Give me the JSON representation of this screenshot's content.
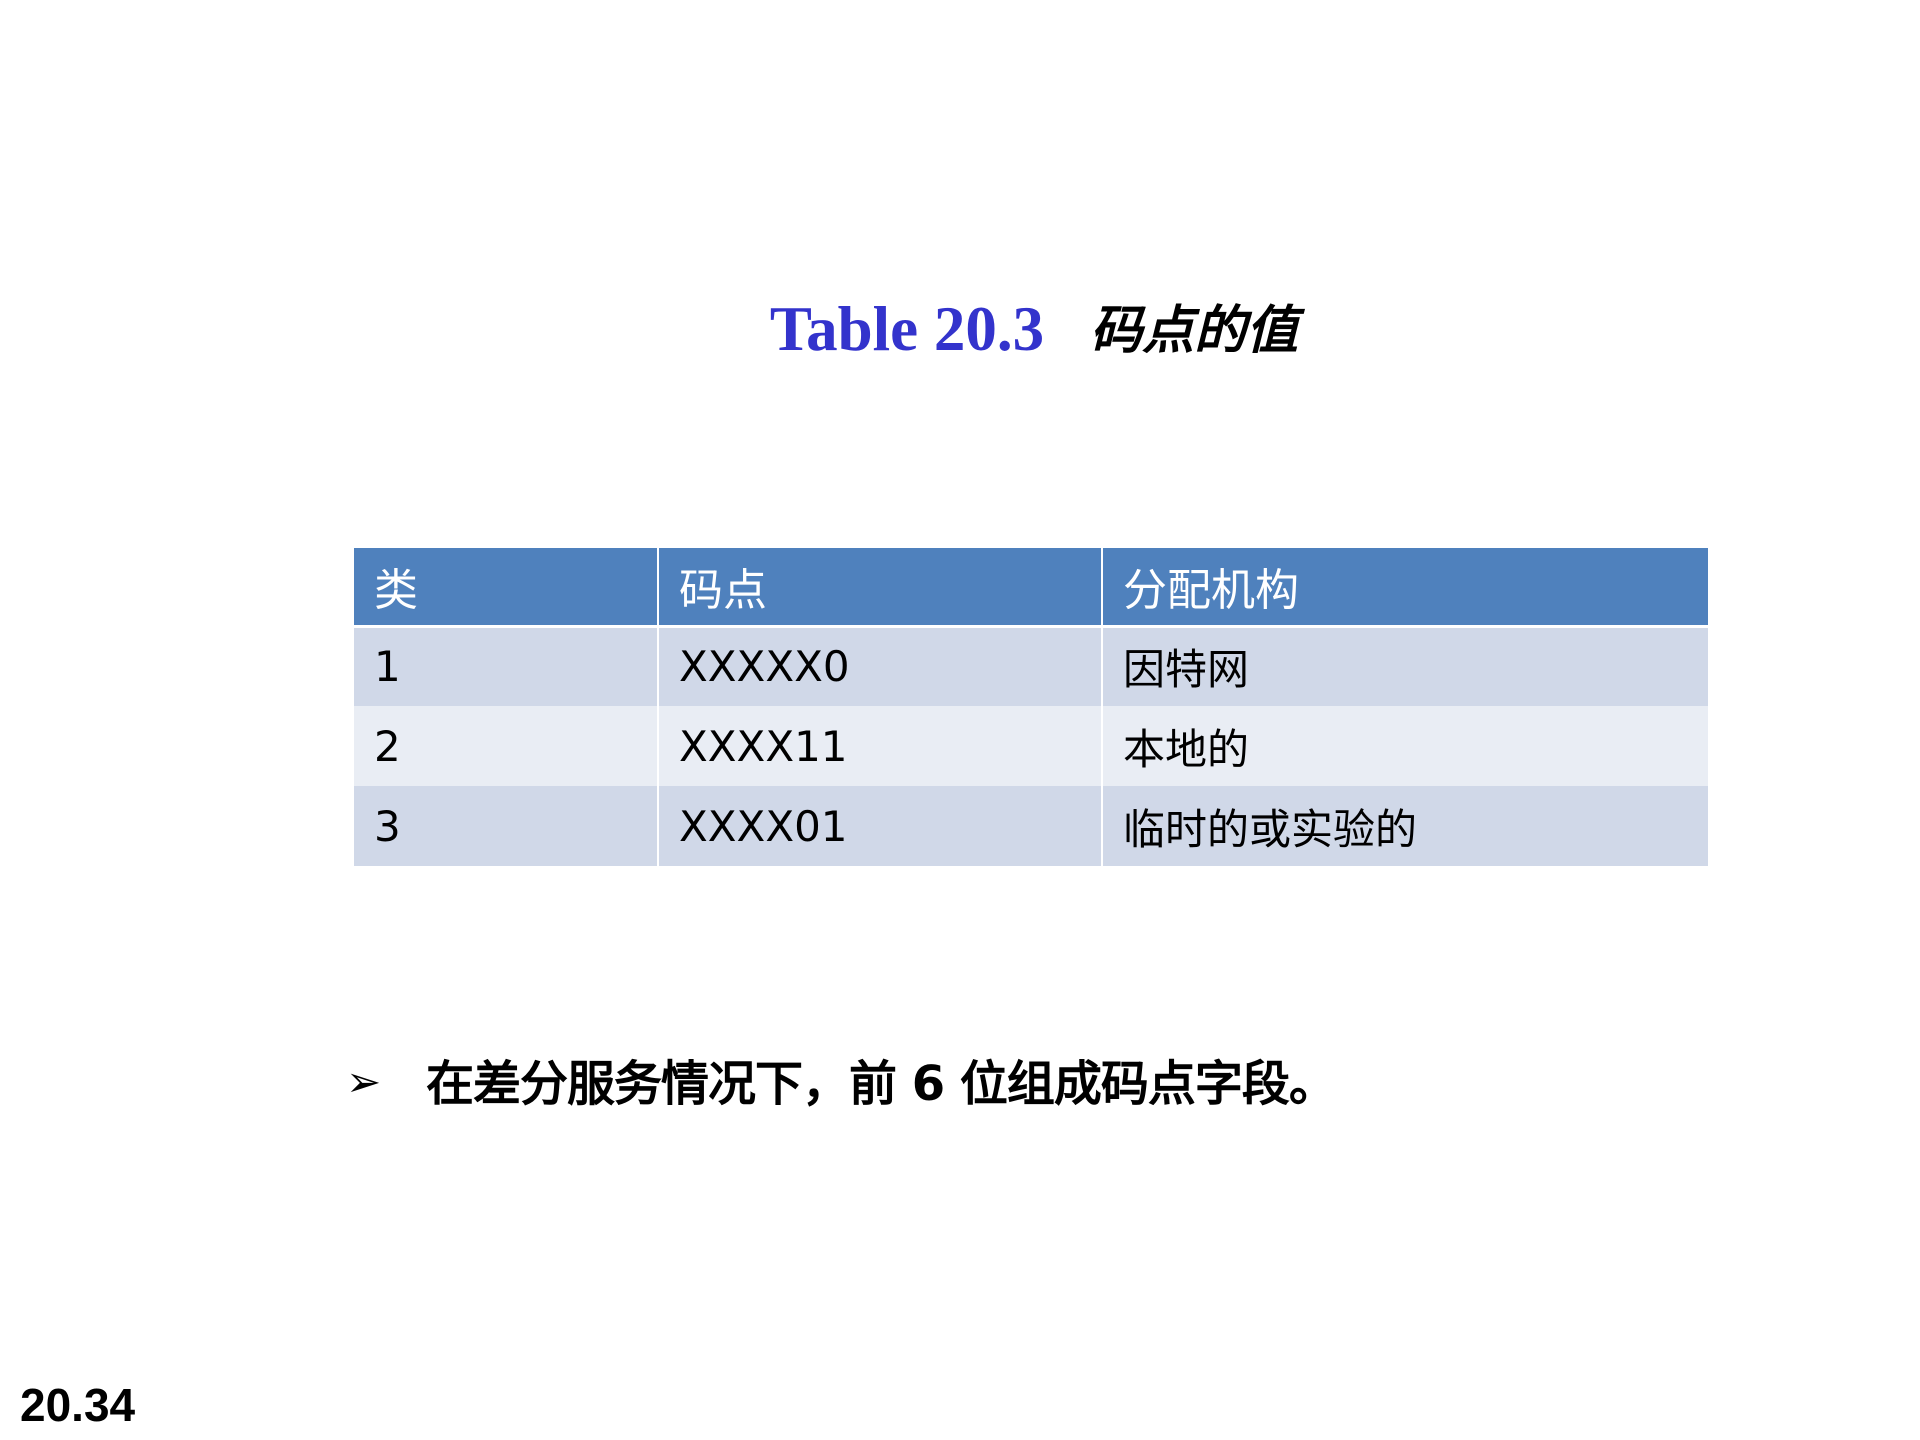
{
  "title": {
    "table_label": "Table 20.3",
    "caption": "码点的值"
  },
  "table": {
    "headers": [
      "类",
      "码点",
      "分配机构"
    ],
    "rows": [
      [
        "1",
        "XXXXX0",
        "因特网"
      ],
      [
        "2",
        "XXXX11",
        "本地的"
      ],
      [
        "3",
        "XXXX01",
        "临时的或实验的"
      ]
    ]
  },
  "bullet": {
    "icon": "arrow-bullet-icon",
    "text": "在差分服务情况下，前 6 位组成码点字段。"
  },
  "page_number": "20.34",
  "colors": {
    "title_blue": "#3333cc",
    "header_bg": "#4f81bd",
    "row_odd_bg": "#d0d8e8",
    "row_even_bg": "#e9edf4"
  }
}
